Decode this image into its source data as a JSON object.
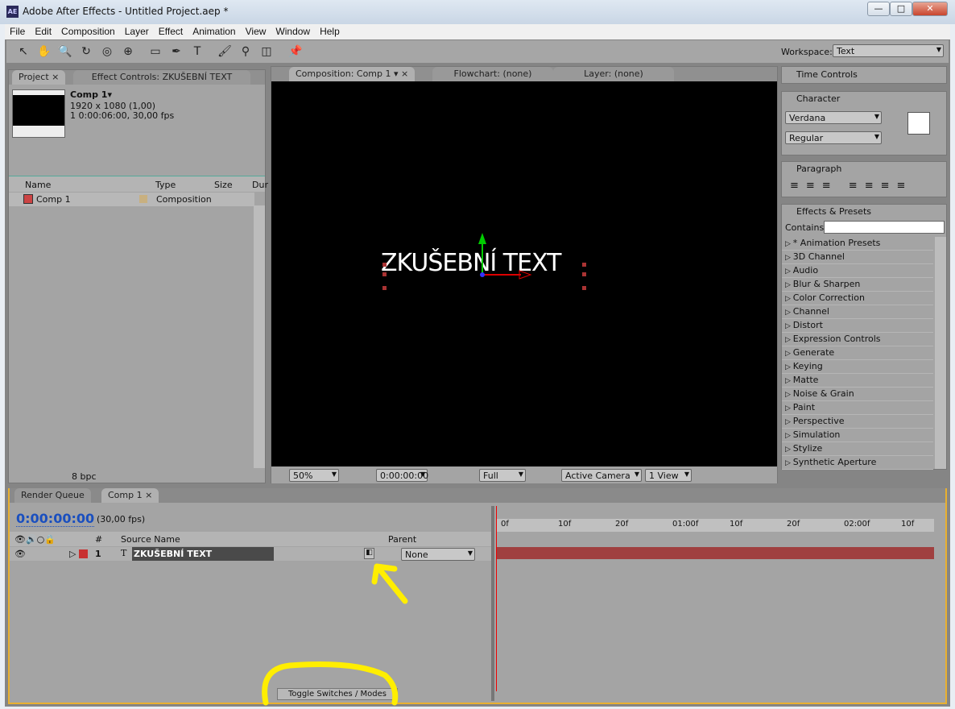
{
  "window": {
    "title": "Adobe After Effects - Untitled Project.aep *",
    "app_icon": "AE",
    "minimize": "—",
    "maximize": "□",
    "close": "✕"
  },
  "menu": [
    "File",
    "Edit",
    "Composition",
    "Layer",
    "Effect",
    "Animation",
    "View",
    "Window",
    "Help"
  ],
  "toolbar": {
    "tools": [
      "selection-icon",
      "hand-icon",
      "zoom-icon",
      "rotate-icon",
      "camera-orbit-icon",
      "pan-behind-icon",
      "rectangle-icon",
      "pen-icon",
      "type-icon",
      "brush-icon",
      "clone-stamp-icon",
      "eraser-icon",
      "puppet-pin-icon"
    ],
    "workspace_label": "Workspace:",
    "workspace_value": "Text"
  },
  "project": {
    "tab": "Project",
    "tab2": "Effect Controls: ZKUŠEBNÍ TEXT",
    "comp_name": "Comp 1▾",
    "comp_res": "1920 x 1080 (1,00)",
    "comp_dur": "1 0:00:06:00, 30,00 fps",
    "columns": [
      "Name",
      "Type",
      "Size",
      "Dur"
    ],
    "items": [
      {
        "name": "Comp 1",
        "type": "Composition"
      }
    ],
    "bpc": "8 bpc"
  },
  "comp": {
    "tabs": [
      "Composition: Comp 1",
      "Flowchart: (none)",
      "Layer: (none)"
    ],
    "text": "ZKUŠEBNÍ TEXT",
    "zoom": "50%",
    "timecode": "0:00:00:00",
    "resolution": "Full",
    "camera": "Active Camera",
    "views": "1 View"
  },
  "right": {
    "time_controls": "Time Controls",
    "character": "Character",
    "font": "Verdana",
    "style": "Regular",
    "paragraph": "Paragraph",
    "effects": "Effects & Presets",
    "contains": "Contains:",
    "effects_list": [
      "* Animation Presets",
      "3D Channel",
      "Audio",
      "Blur & Sharpen",
      "Color Correction",
      "Channel",
      "Distort",
      "Expression Controls",
      "Generate",
      "Keying",
      "Matte",
      "Noise & Grain",
      "Paint",
      "Perspective",
      "Simulation",
      "Stylize",
      "Synthetic Aperture"
    ]
  },
  "timeline": {
    "tabs": [
      "Render Queue",
      "Comp 1"
    ],
    "timecode": "0:00:00:00",
    "fps": "(30,00 fps)",
    "col_num": "#",
    "col_source": "Source Name",
    "col_parent": "Parent",
    "layer": {
      "num": "1",
      "type": "T",
      "name": "ZKUŠEBNÍ TEXT",
      "parent": "None",
      "label_color": "#c83030"
    },
    "ruler": [
      "0f",
      "10f",
      "20f",
      "01:00f",
      "10f",
      "20f",
      "02:00f",
      "10f"
    ],
    "toggle": "Toggle Switches / Modes"
  },
  "colors": {
    "accent_timecode": "#1a4fbf",
    "annotation": "#ffee00",
    "panel_highlight": "#e8b030"
  }
}
